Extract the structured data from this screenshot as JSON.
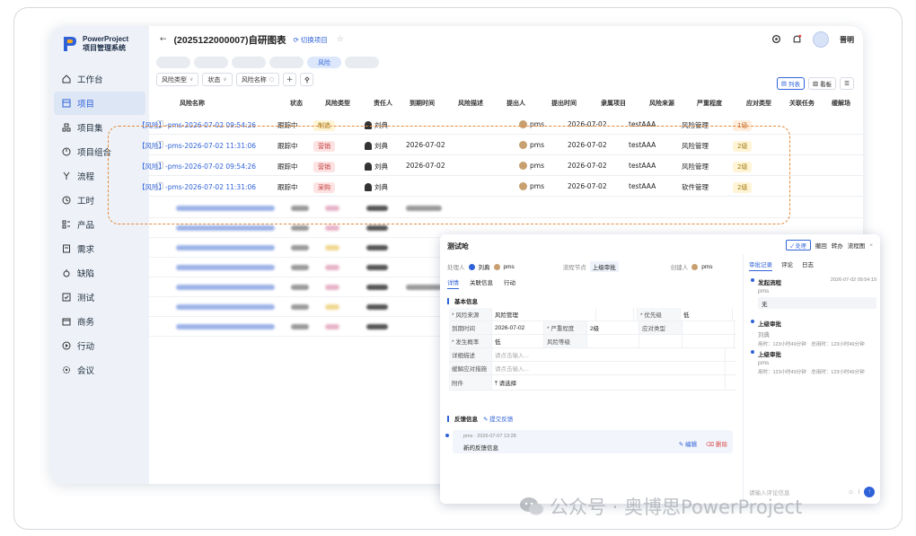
{
  "app": {
    "logo_line1": "PowerProject",
    "logo_line2": "项目管理系统"
  },
  "nav": [
    "工作台",
    "项目",
    "项目集",
    "项目组合",
    "流程",
    "工时",
    "产品",
    "需求",
    "缺陷",
    "测试",
    "商务",
    "行动",
    "会议"
  ],
  "header": {
    "back": "←",
    "title": "(2025122000007)自研图表",
    "switch": "切换项目",
    "star": "☆",
    "user": "晋明"
  },
  "pills": [
    "",
    "",
    "",
    "",
    "风险",
    ""
  ],
  "filters": [
    "风险类型",
    "状态",
    "风险名称",
    "+"
  ],
  "views": [
    "列表",
    "看板"
  ],
  "columns": [
    "风险名称",
    "状态",
    "风险类型",
    "责任人",
    "到期时间",
    "风险描述",
    "提出人",
    "提出时间",
    "隶属项目",
    "风险来源",
    "严重程度",
    "应对类型",
    "关联任务",
    "缓解场"
  ],
  "rows": [
    {
      "name": "【风险】-pms-2026-07-02 09:54:26",
      "status": "跟踪中",
      "type": "制造",
      "owner": "刘典",
      "due": "",
      "creator": "pms",
      "created": "2026-07-02",
      "project": "testAAA",
      "source": "风险管理",
      "level": "1级"
    },
    {
      "name": "【风险】-pms-2026-07-02 11:31:06",
      "status": "跟踪中",
      "type": "营销",
      "owner": "刘典",
      "due": "2026-07-02",
      "creator": "pms",
      "created": "2026-07-02",
      "project": "testAAA",
      "source": "风险管理",
      "level": "2级"
    },
    {
      "name": "【风险】-pms-2026-07-02 09:54:26",
      "status": "跟踪中",
      "type": "营销",
      "owner": "刘典",
      "due": "2026-07-02",
      "creator": "pms",
      "created": "2026-07-02",
      "project": "testAAA",
      "source": "风险管理",
      "level": "2级"
    },
    {
      "name": "【风险】-pms-2026-07-02 11:31:06",
      "status": "跟踪中",
      "type": "采购",
      "owner": "刘典",
      "due": "",
      "creator": "pms",
      "created": "2026-07-02",
      "project": "testAAA",
      "source": "软件管理",
      "level": "2级"
    }
  ],
  "dialog": {
    "title": "测试呛",
    "tools": [
      "✓ 处理",
      "撤回",
      "转办",
      "流程图",
      "×"
    ],
    "meta": {
      "l1": "处理人",
      "v1": "刘典",
      "v1b": "pms",
      "l2": "流程节点",
      "v2": "上级审批",
      "l3": "创建人",
      "v3": "pms"
    },
    "tabs": [
      "详情",
      "关联信息",
      "行动"
    ],
    "sec1": "基本信息",
    "form": [
      [
        "* 风险来源",
        "风险管理",
        "",
        "",
        "* 优先级",
        "低"
      ],
      [
        "到期时间",
        "2026-07-02",
        "* 严重程度",
        "2级",
        "应对类型",
        ""
      ],
      [
        "* 发生概率",
        "低",
        "风险等级",
        "",
        "",
        ""
      ],
      [
        "详细描述",
        "请点击输入...",
        "",
        "",
        "",
        ""
      ],
      [
        "缓解应对措施",
        "请点击输入...",
        "",
        "",
        "",
        ""
      ],
      [
        "附件",
        "⤒ 请选择",
        "",
        "",
        "",
        ""
      ]
    ],
    "sec2": "反馈信息",
    "sec2_link": "✎ 提交反馈",
    "fb_meta": "pms · 2026-07-07 13:28",
    "fb_text": "新的反馈信息",
    "fb_edit": "✎ 编辑",
    "fb_del": "⌫ 删除",
    "rtabs": [
      "审批记录",
      "评论",
      "日志"
    ],
    "tl": [
      {
        "t": "发起流程",
        "time": "2026-07-02 09:54:19",
        "s": "pms",
        "box": "无"
      },
      {
        "t": "上级审批",
        "s": "刘典",
        "s2": "用时：123小时49分钟　总用时：123小时49分钟"
      },
      {
        "t": "上级审批",
        "s": "pms",
        "s2": "用时：123小时49分钟　总用时：123小时49分钟"
      }
    ],
    "comment": "请输入评论信息"
  },
  "watermark": "公众号 · 奥博思PowerProject"
}
